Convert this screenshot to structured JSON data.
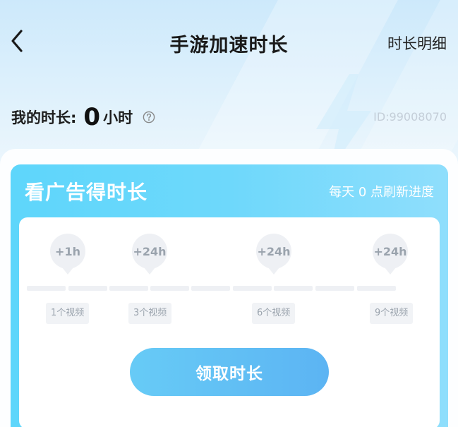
{
  "header": {
    "title": "手游加速时长",
    "detail_link": "时长明细",
    "back_icon": "chevron-left-icon"
  },
  "summary": {
    "label": "我的时长:",
    "value": "0",
    "unit": "小时",
    "help_icon": "question-circle-icon",
    "user_id": "ID:99008070"
  },
  "task_card": {
    "title": "看广告得时长",
    "subtitle": "每天 0 点刷新进度",
    "milestones": [
      {
        "reward": "+1h",
        "label": "1个视频"
      },
      {
        "reward": "+24h",
        "label": "3个视频"
      },
      {
        "reward": "+24h",
        "label": "6个视频"
      },
      {
        "reward": "+24h",
        "label": "9个视频"
      }
    ],
    "progress": {
      "watched": 0,
      "total": 9
    },
    "claim_button": "领取时长"
  },
  "colors": {
    "card_gradient_start": "#5ed6fb",
    "button_gradient_end": "#5cb4f3",
    "milestone_inactive": "#eef0f4"
  }
}
